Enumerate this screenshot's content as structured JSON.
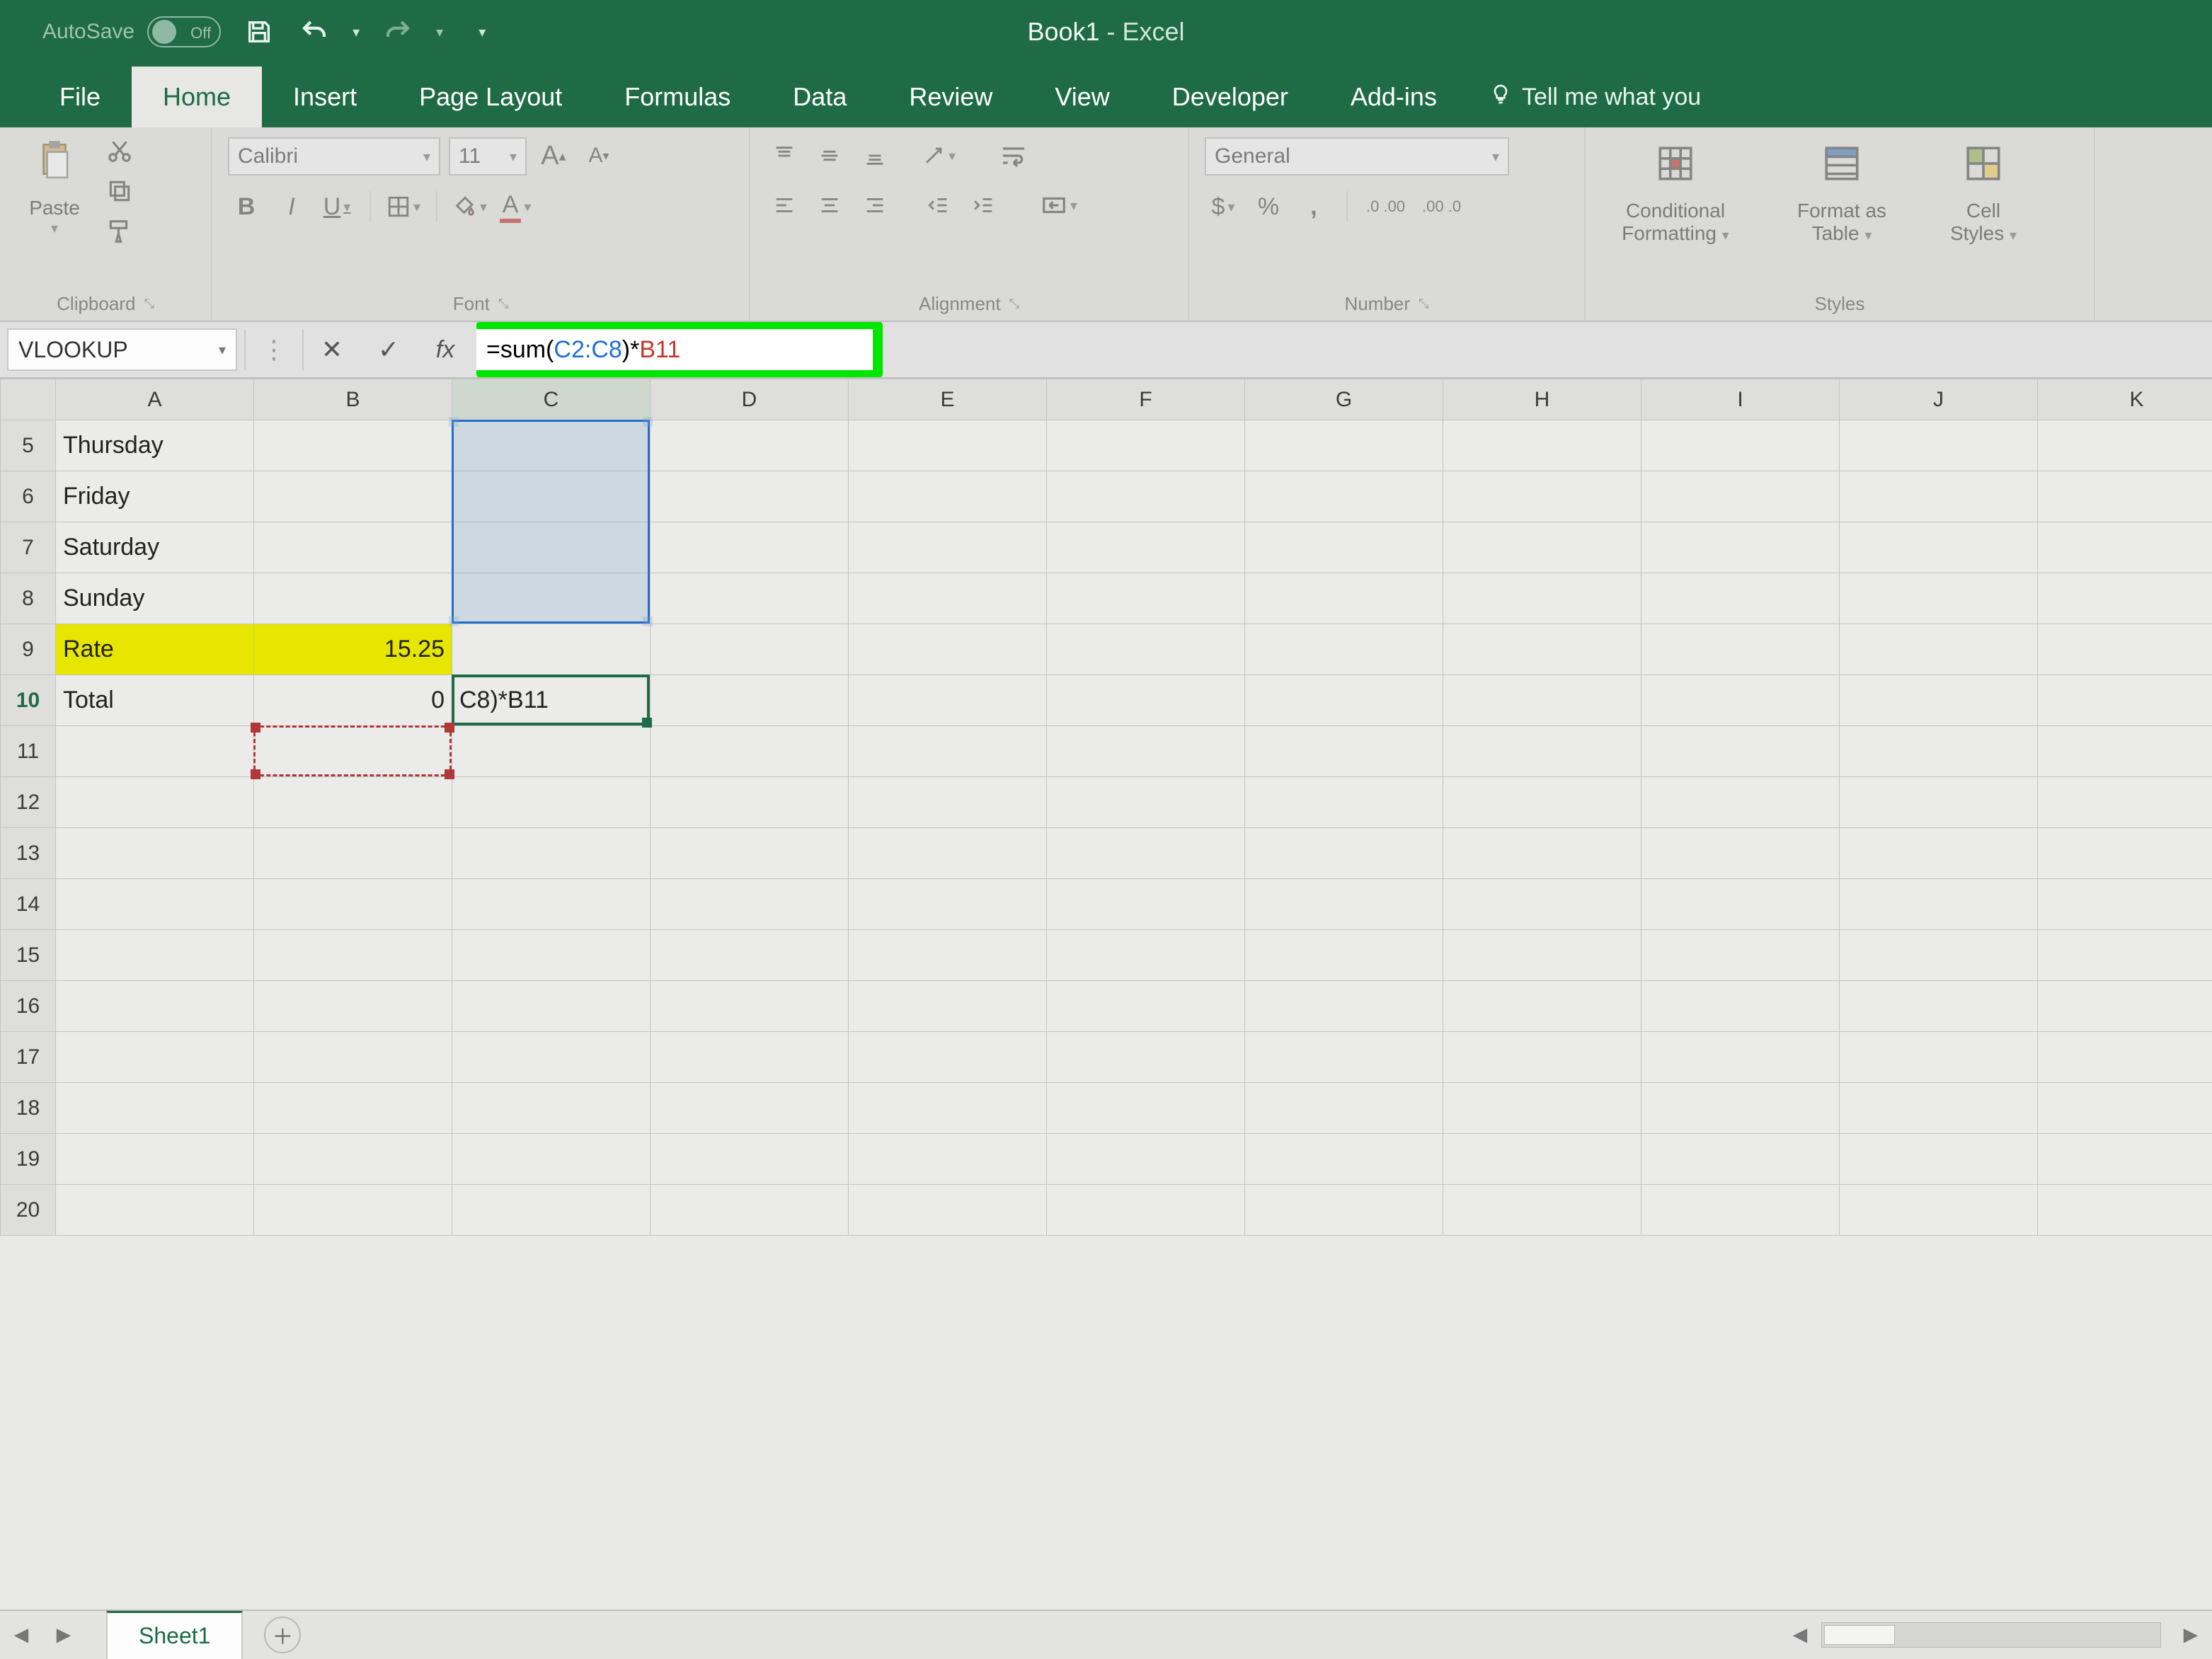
{
  "title": {
    "doc": "Book1",
    "sep": "  -  ",
    "app": "Excel"
  },
  "qat": {
    "autosave": "AutoSave",
    "autosave_state": "Off"
  },
  "tabs": {
    "file": "File",
    "home": "Home",
    "insert": "Insert",
    "pagelayout": "Page Layout",
    "formulas": "Formulas",
    "data": "Data",
    "review": "Review",
    "view": "View",
    "developer": "Developer",
    "addins": "Add-ins",
    "tellme": "Tell me what you"
  },
  "ribbon": {
    "clipboard": {
      "paste": "Paste",
      "label": "Clipboard"
    },
    "font": {
      "name": "Calibri",
      "size": "11",
      "label": "Font",
      "bold": "B",
      "italic": "I",
      "underline": "U",
      "inc": "A",
      "dec": "A"
    },
    "alignment": {
      "label": "Alignment"
    },
    "number": {
      "format": "General",
      "label": "Number",
      "currency": "$",
      "percent": "%",
      "comma": ",",
      "inc": ".0 .00",
      "dec": ".00 .0"
    },
    "styles": {
      "cond1": "Conditional",
      "cond2": "Formatting",
      "fmt1": "Format as",
      "fmt2": "Table",
      "cell1": "Cell",
      "cell2": "Styles",
      "label": "Styles"
    }
  },
  "formulabar": {
    "namebox": "VLOOKUP",
    "formula_prefix": "=sum(",
    "ref1": "C2:C8",
    "mid": ")*",
    "ref2": "B11",
    "fx": "fx"
  },
  "grid": {
    "cols": [
      "A",
      "B",
      "C",
      "D",
      "E",
      "F",
      "G",
      "H",
      "I",
      "J",
      "K"
    ],
    "rows": [
      {
        "n": 5,
        "A": "Thursday"
      },
      {
        "n": 6,
        "A": "Friday"
      },
      {
        "n": 7,
        "A": "Saturday"
      },
      {
        "n": 8,
        "A": "Sunday"
      },
      {
        "n": 9,
        "A": "Rate",
        "B": "15.25",
        "yellow": true
      },
      {
        "n": 10,
        "A": "Total",
        "B": "0",
        "C": "C8)*B11",
        "editing": true
      },
      {
        "n": 11
      },
      {
        "n": 12
      },
      {
        "n": 13
      },
      {
        "n": 14
      },
      {
        "n": 15
      },
      {
        "n": 16
      },
      {
        "n": 17
      },
      {
        "n": 18
      },
      {
        "n": 19
      },
      {
        "n": 20
      }
    ]
  },
  "sheetbar": {
    "sheet1": "Sheet1"
  }
}
